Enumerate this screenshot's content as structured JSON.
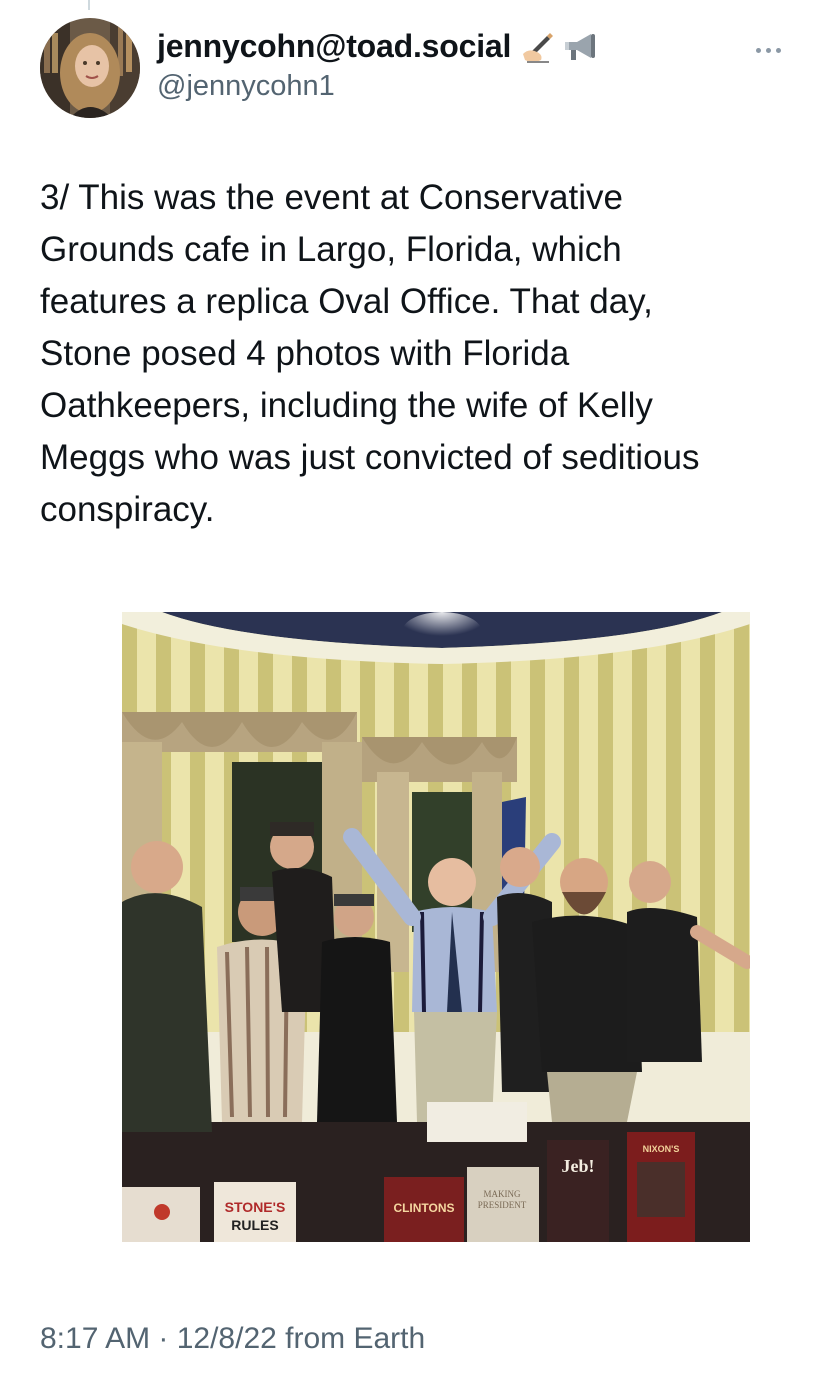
{
  "author": {
    "display_name": "jennycohn@toad.social",
    "handle": "@jennycohn1",
    "badges": [
      "writing-hand-icon",
      "megaphone-icon"
    ]
  },
  "tweet": {
    "text": "3/ This was the event at Conservative\nGrounds cafe in Largo, Florida, which\nfeatures a replica Oval Office. That day,\nStone posed 4 photos with Florida\nOathkeepers, including the wife of Kelly\nMeggs who was just convicted of seditious\nconspiracy."
  },
  "photo": {
    "books": {
      "stones_rules": "STONE'S RULES",
      "clintons": "CLINTONS",
      "jeb": "Jeb!",
      "nixons": "NIXON'S",
      "making": "MAKING PRESIDENT"
    }
  },
  "meta": {
    "time": "8:17 AM",
    "date": "12/8/22",
    "source": "from Earth",
    "timestamp_line": "8:17 AM · 12/8/22 from Earth"
  },
  "colors": {
    "text_primary": "#0f1419",
    "text_secondary": "#536471",
    "wallpaper_stripe_light": "#e8e2a9",
    "wallpaper_stripe_dark": "#cfc57a"
  }
}
